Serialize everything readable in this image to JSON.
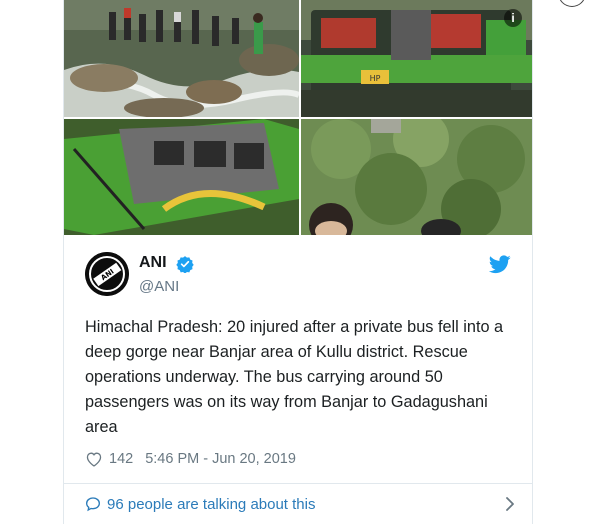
{
  "tweet": {
    "author_name": "ANI",
    "author_handle": "@ANI",
    "text": "Himachal Pradesh: 20 injured after a private bus fell into a deep gorge near Banjar area of Kullu district. Rescue operations underway. The bus carrying around 50 passengers was on its way from Banjar to Gadagushani area",
    "like_count": "142",
    "timestamp": "5:46 PM - Jun 20, 2019",
    "talking_about": "96 people are talking about this",
    "bus_plate_text": "HP",
    "avatar_text": "ANI"
  },
  "media": {
    "info_glyph": "i"
  },
  "icons": {
    "verified": "verified-badge-icon",
    "bird": "twitter-bird-icon",
    "heart": "heart-icon",
    "bubble": "speech-bubble-icon",
    "chevron": "chevron-right-icon"
  },
  "colors": {
    "brand_blue": "#1da1f2",
    "link_blue": "#2b7bb9",
    "meta_gray": "#697882",
    "text": "#1c2022",
    "border": "#e1e8ed"
  }
}
